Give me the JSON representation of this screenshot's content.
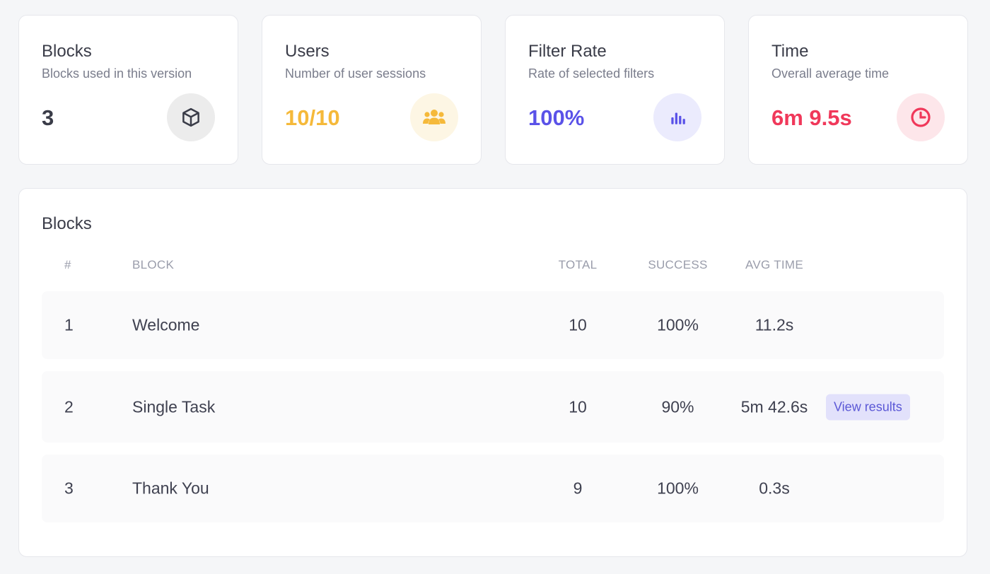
{
  "stats": [
    {
      "title": "Blocks",
      "description": "Blocks used in this version",
      "value": "3",
      "icon": "cube-icon",
      "color": "#3a3c48",
      "icon_bg": "#ececec",
      "icon_color": "#3a3c48"
    },
    {
      "title": "Users",
      "description": "Number of user sessions",
      "value": "10/10",
      "icon": "users-icon",
      "color": "#f5b93a",
      "icon_bg": "#fdf6e4",
      "icon_color": "#f5b93a"
    },
    {
      "title": "Filter Rate",
      "description": "Rate of selected filters",
      "value": "100%",
      "icon": "bar-chart-icon",
      "color": "#5a52e8",
      "icon_bg": "#ebebfd",
      "icon_color": "#5a52e8"
    },
    {
      "title": "Time",
      "description": "Overall average time",
      "value": "6m 9.5s",
      "icon": "clock-icon",
      "color": "#f0385a",
      "icon_bg": "#fde6ea",
      "icon_color": "#f0385a"
    }
  ],
  "blocks_panel": {
    "title": "Blocks",
    "columns": {
      "num": "#",
      "block": "BLOCK",
      "total": "TOTAL",
      "success": "SUCCESS",
      "avg_time": "AVG TIME"
    },
    "rows": [
      {
        "num": "1",
        "block": "Welcome",
        "total": "10",
        "success": "100%",
        "avg_time": "11.2s",
        "action": ""
      },
      {
        "num": "2",
        "block": "Single Task",
        "total": "10",
        "success": "90%",
        "avg_time": "5m 42.6s",
        "action": "View results"
      },
      {
        "num": "3",
        "block": "Thank You",
        "total": "9",
        "success": "100%",
        "avg_time": "0.3s",
        "action": ""
      }
    ]
  }
}
